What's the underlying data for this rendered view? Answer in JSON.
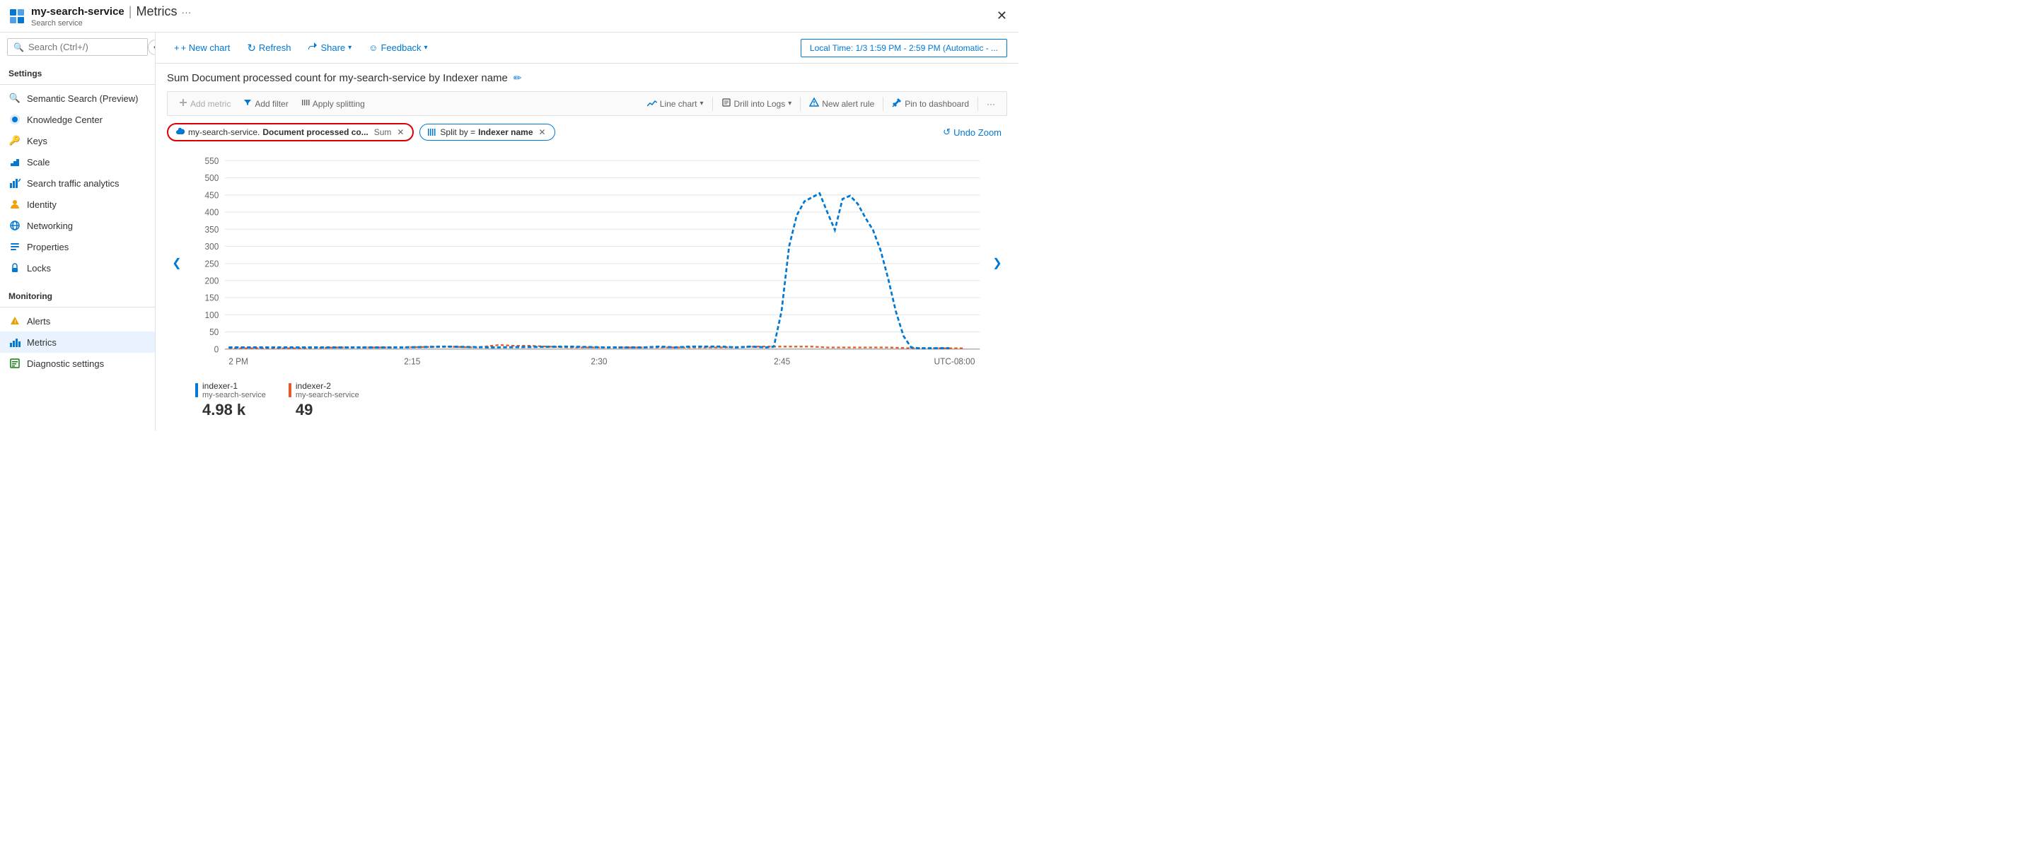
{
  "header": {
    "logo_alt": "Azure Search",
    "service_name": "my-search-service",
    "separator": "|",
    "page_title": "Metrics",
    "ellipsis": "···",
    "subtitle": "Search service",
    "close_btn": "✕"
  },
  "sidebar": {
    "search_placeholder": "Search (Ctrl+/)",
    "collapse_icon": "«",
    "sections": [
      {
        "label": "Settings",
        "items": [
          {
            "id": "semantic-search",
            "label": "Semantic Search (Preview)",
            "icon": "🔍",
            "icon_color": "#0078d4"
          },
          {
            "id": "knowledge-center",
            "label": "Knowledge Center",
            "icon": "☁",
            "icon_color": "#0078d4"
          },
          {
            "id": "keys",
            "label": "Keys",
            "icon": "🔑",
            "icon_color": "#f0a30a"
          },
          {
            "id": "scale",
            "label": "Scale",
            "icon": "📐",
            "icon_color": "#0078d4"
          },
          {
            "id": "search-traffic-analytics",
            "label": "Search traffic analytics",
            "icon": "📊",
            "icon_color": "#0078d4"
          },
          {
            "id": "identity",
            "label": "Identity",
            "icon": "💡",
            "icon_color": "#f0a30a"
          },
          {
            "id": "networking",
            "label": "Networking",
            "icon": "🌐",
            "icon_color": "#0078d4"
          },
          {
            "id": "properties",
            "label": "Properties",
            "icon": "🔧",
            "icon_color": "#0078d4"
          },
          {
            "id": "locks",
            "label": "Locks",
            "icon": "🔒",
            "icon_color": "#0078d4"
          }
        ]
      },
      {
        "label": "Monitoring",
        "items": [
          {
            "id": "alerts",
            "label": "Alerts",
            "icon": "🔔",
            "icon_color": "#e8a000"
          },
          {
            "id": "metrics",
            "label": "Metrics",
            "icon": "📈",
            "icon_color": "#0078d4",
            "active": true
          },
          {
            "id": "diagnostic-settings",
            "label": "Diagnostic settings",
            "icon": "📋",
            "icon_color": "#107c10"
          }
        ]
      }
    ]
  },
  "toolbar": {
    "new_chart_label": "+ New chart",
    "refresh_label": "↻ Refresh",
    "share_label": "Share",
    "share_icon": "↗",
    "feedback_label": "Feedback",
    "feedback_icon": "☺",
    "time_range_label": "Local Time: 1/3 1:59 PM - 2:59 PM (Automatic - ..."
  },
  "chart": {
    "title": "Sum Document processed count for my-search-service by Indexer name",
    "edit_icon": "✏",
    "metric_buttons": [
      {
        "id": "add-metric",
        "label": "Add metric",
        "icon": "✦",
        "disabled": false
      },
      {
        "id": "add-filter",
        "label": "Add filter",
        "icon": "▼",
        "disabled": false,
        "accent": true
      },
      {
        "id": "apply-splitting",
        "label": "Apply splitting",
        "icon": "⋮⋮",
        "disabled": false
      }
    ],
    "right_buttons": [
      {
        "id": "line-chart",
        "label": "Line chart",
        "icon": "📈",
        "has_dropdown": true
      },
      {
        "id": "drill-into-logs",
        "label": "Drill into Logs",
        "has_dropdown": true
      },
      {
        "id": "new-alert-rule",
        "label": "New alert rule",
        "icon": "🔔"
      },
      {
        "id": "pin-to-dashboard",
        "label": "Pin to dashboard",
        "icon": "📌"
      },
      {
        "id": "more-options",
        "label": "···"
      }
    ],
    "chips": [
      {
        "id": "metric-chip",
        "icon": "☁",
        "icon_color": "#0078d4",
        "label": "my-search-service.",
        "label_bold": "Document processed co...",
        "suffix": "Sum",
        "has_close": true,
        "active": true
      },
      {
        "id": "split-chip",
        "icon": "⋮⋮",
        "icon_color": "#0078d4",
        "prefix": "Split by = ",
        "label_bold": "Indexer name",
        "has_close": true,
        "active": false
      }
    ],
    "undo_zoom": "↺ Undo Zoom",
    "y_axis": [
      550,
      500,
      450,
      400,
      350,
      300,
      250,
      200,
      150,
      100,
      50,
      0
    ],
    "x_axis": [
      "2 PM",
      "2:15",
      "2:30",
      "2:45",
      "UTC-08:00"
    ],
    "nav_left": "❮",
    "nav_right": "❯",
    "legend": [
      {
        "id": "indexer-1",
        "color": "#0078d4",
        "name": "indexer-1",
        "service": "my-search-service",
        "value": "4.98 k",
        "line_style": "solid"
      },
      {
        "id": "indexer-2",
        "color": "#e05c2a",
        "name": "indexer-2",
        "service": "my-search-service",
        "value": "49",
        "line_style": "solid"
      }
    ]
  }
}
